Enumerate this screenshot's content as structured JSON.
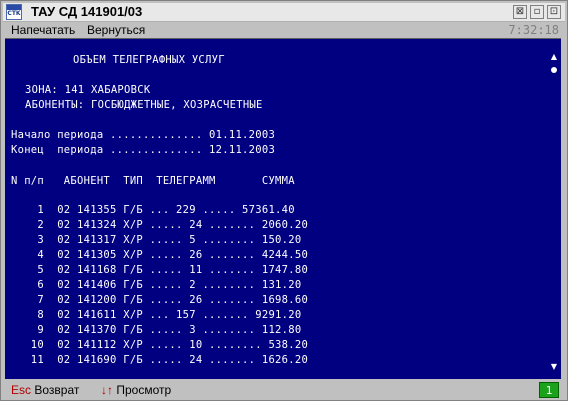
{
  "window": {
    "title": "ТАУ СД 141901/03",
    "icon_label": "CTK",
    "buttons": {
      "pin": "⊠",
      "restore": "▫",
      "maximize": "⊡"
    }
  },
  "menu": {
    "print": "Напечатать",
    "back": "Вернуться",
    "clock": "7:32:18"
  },
  "report": {
    "title": "ОБЪЕМ ТЕЛЕГРАФНЫХ УСЛУГ",
    "zone": "ЗОНА: 141 ХАБАРОВСК",
    "subscribers": "АБОНЕНТЫ: ГОСБЮДЖЕТНЫЕ, ХОЗРАСЧЕТНЫЕ",
    "period_start": "Начало периода .............. 01.11.2003",
    "period_end": "Конец  периода .............. 12.11.2003",
    "header": "N п/п   АБОНЕНТ  ТИП  ТЕЛЕГРАММ       СУММА",
    "rows": [
      "    1  02 141355 Г/Б ... 229 ..... 57361.40",
      "    2  02 141324 Х/Р ..... 24 ....... 2060.20",
      "    3  02 141317 Х/Р ..... 5 ........ 150.20",
      "    4  02 141305 Х/Р ..... 26 ....... 4244.50",
      "    5  02 141168 Г/Б ..... 11 ....... 1747.80",
      "    6  02 141406 Г/Б ..... 2 ........ 131.20",
      "    7  02 141200 Г/Б ..... 26 ....... 1698.60",
      "    8  02 141611 Х/Р ... 157 ....... 9291.20",
      "    9  02 141370 Г/Б ..... 3 ........ 112.80",
      "   10  02 141112 Х/Р ..... 10 ........ 538.20",
      "   11  02 141690 Г/Б ..... 24 ....... 1626.20"
    ]
  },
  "status": {
    "esc_key": "Esc",
    "esc_label": "Возврат",
    "arrows_key": "↓↑",
    "arrows_label": "Просмотр",
    "page": "1"
  },
  "icons": {
    "scroll_up": "▲",
    "scroll_down": "▼"
  },
  "colors": {
    "screen_bg": "#000080",
    "text": "#ffffff",
    "key": "#b00000",
    "page_indicator": "#1aa31a"
  }
}
